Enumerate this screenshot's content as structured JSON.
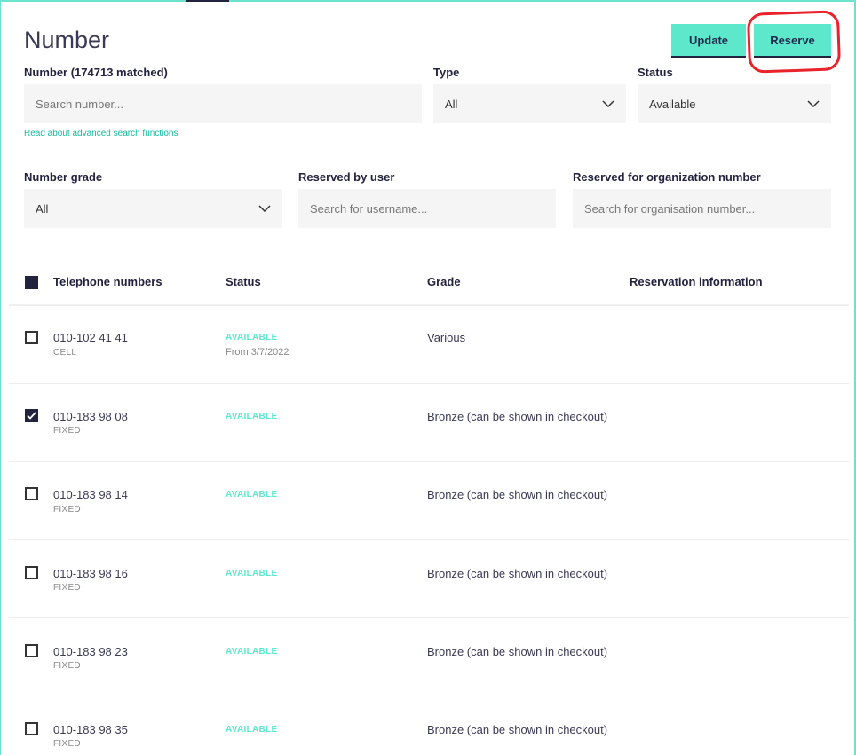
{
  "page": {
    "title": "Number"
  },
  "actions": {
    "update_label": "Update",
    "reserve_label": "Reserve"
  },
  "filters": {
    "number_label": "Number (174713 matched)",
    "number_placeholder": "Search number...",
    "advanced_link": "Read about advanced search functions",
    "type_label": "Type",
    "type_value": "All",
    "status_label": "Status",
    "status_value": "Available",
    "grade_label": "Number grade",
    "grade_value": "All",
    "reserved_user_label": "Reserved by user",
    "reserved_user_placeholder": "Search for username...",
    "reserved_org_label": "Reserved for organization number",
    "reserved_org_placeholder": "Search for organisation number..."
  },
  "table": {
    "headers": [
      "Telephone numbers",
      "Status",
      "Grade",
      "Reservation information"
    ],
    "rows": [
      {
        "number": "010-102 41 41",
        "type": "CELL",
        "status": "AVAILABLE",
        "from": "From 3/7/2022",
        "grade": "Various",
        "checked": false
      },
      {
        "number": "010-183 98 08",
        "type": "FIXED",
        "status": "AVAILABLE",
        "from": "",
        "grade": "Bronze (can be shown in checkout)",
        "checked": true
      },
      {
        "number": "010-183 98 14",
        "type": "FIXED",
        "status": "AVAILABLE",
        "from": "",
        "grade": "Bronze (can be shown in checkout)",
        "checked": false
      },
      {
        "number": "010-183 98 16",
        "type": "FIXED",
        "status": "AVAILABLE",
        "from": "",
        "grade": "Bronze (can be shown in checkout)",
        "checked": false
      },
      {
        "number": "010-183 98 23",
        "type": "FIXED",
        "status": "AVAILABLE",
        "from": "",
        "grade": "Bronze (can be shown in checkout)",
        "checked": false
      },
      {
        "number": "010-183 98 35",
        "type": "FIXED",
        "status": "AVAILABLE",
        "from": "",
        "grade": "Bronze (can be shown in checkout)",
        "checked": false
      }
    ]
  },
  "colors": {
    "accent": "#5de8cc",
    "dark": "#23223f",
    "annotation": "#e8232b",
    "link": "#14b89a"
  },
  "icons": {
    "select_chevron": "chevron-down-icon",
    "checkbox_check": "check-icon"
  }
}
